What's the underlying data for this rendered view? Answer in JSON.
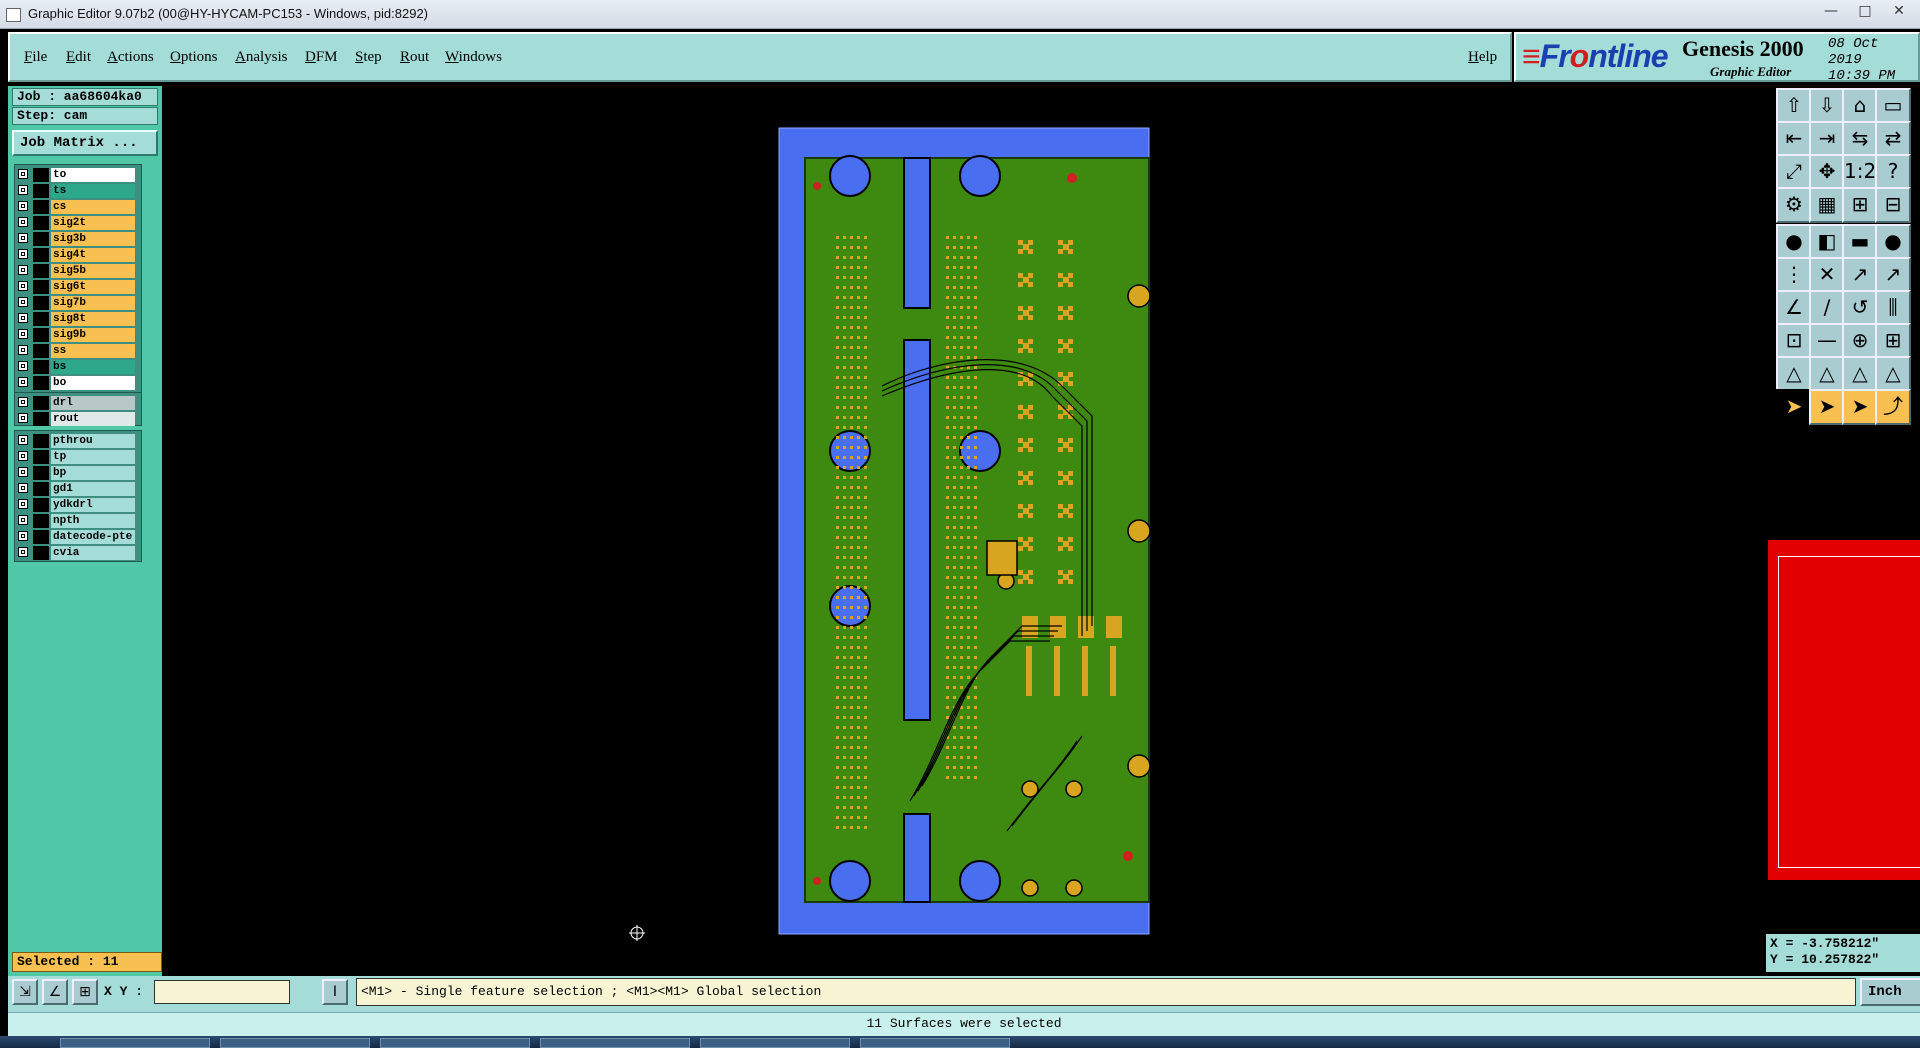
{
  "window": {
    "title": "Graphic Editor 9.07b2 (00@HY-HYCAM-PC153 - Windows, pid:8292)"
  },
  "menu": {
    "items": [
      "File",
      "Edit",
      "Actions",
      "Options",
      "Analysis",
      "DFM",
      "Step",
      "Rout",
      "Windows"
    ],
    "help": "Help"
  },
  "logo": {
    "brand_pre": "Fr",
    "brand_o": "o",
    "brand_post": "ntline",
    "product": "Genesis 2000",
    "subtitle": "Graphic Editor",
    "date": "08 Oct 2019",
    "time": "10:39 PM"
  },
  "job": {
    "job_label": "Job : aa68604ka0",
    "step_label": "Step: cam",
    "matrix_button": "Job Matrix ..."
  },
  "layers": {
    "board": [
      {
        "name": "to",
        "color": "#ffffff"
      },
      {
        "name": "ts",
        "color": "#2ea88a"
      },
      {
        "name": "cs",
        "color": "#f8c050"
      },
      {
        "name": "sig2t",
        "color": "#f8c050"
      },
      {
        "name": "sig3b",
        "color": "#f8c050"
      },
      {
        "name": "sig4t",
        "color": "#f8c050"
      },
      {
        "name": "sig5b",
        "color": "#f8c050"
      },
      {
        "name": "sig6t",
        "color": "#f8c050"
      },
      {
        "name": "sig7b",
        "color": "#f8c050"
      },
      {
        "name": "sig8t",
        "color": "#f8c050"
      },
      {
        "name": "sig9b",
        "color": "#f8c050"
      },
      {
        "name": "ss",
        "color": "#f8c050"
      },
      {
        "name": "bs",
        "color": "#2ea88a"
      },
      {
        "name": "bo",
        "color": "#ffffff"
      }
    ],
    "drill": [
      {
        "name": "drl",
        "color": "#b8c8c8"
      },
      {
        "name": "rout",
        "color": "#e0e8e8"
      }
    ],
    "misc": [
      {
        "name": "pthrou",
        "color": "#a4dcd8"
      },
      {
        "name": "tp",
        "color": "#a4dcd8"
      },
      {
        "name": "bp",
        "color": "#a4dcd8"
      },
      {
        "name": "gd1",
        "color": "#a4dcd8"
      },
      {
        "name": "ydkdrl",
        "color": "#a4dcd8"
      },
      {
        "name": "npth",
        "color": "#a4dcd8"
      },
      {
        "name": "datecode-pte",
        "color": "#a4dcd8"
      },
      {
        "name": "cvia",
        "color": "#a4dcd8"
      }
    ]
  },
  "selection": {
    "label": "Selected : 11"
  },
  "coords": {
    "x": "X = -3.758212\"",
    "y": "Y = 10.257822\""
  },
  "bottom": {
    "xy_label": "X Y :",
    "xy_value": "",
    "hint": "<M1> - Single feature selection ; <M1><M1> Global selection",
    "units": "Inch"
  },
  "status": {
    "message": "11 Surfaces were selected"
  },
  "colors": {
    "panel": "#50c8a8",
    "menubar": "#a4dcd8",
    "board_frame": "#4a6ef0",
    "board_fill": "#3e8a10",
    "pads": "#d8a520",
    "minimap": "#e30000"
  },
  "toolbar_icons": [
    "tool-icon-1",
    "tool-icon-2"
  ]
}
